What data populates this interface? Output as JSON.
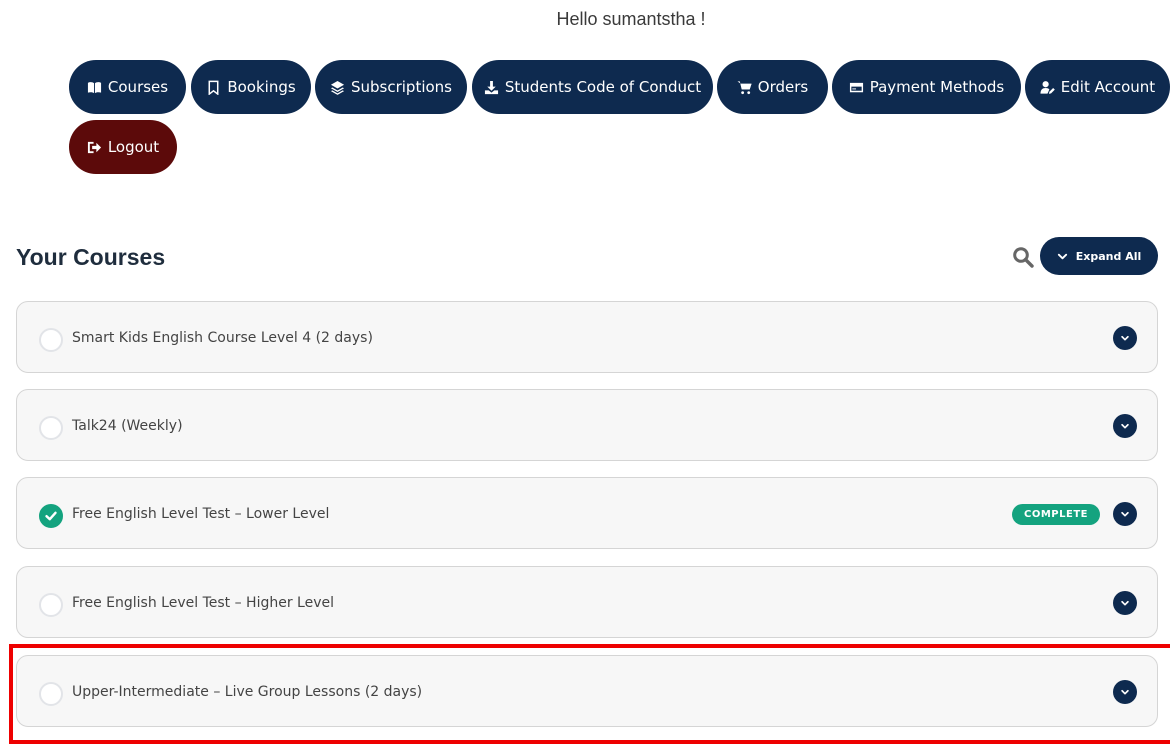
{
  "greeting": "Hello sumantstha !",
  "nav": {
    "courses": "Courses",
    "bookings": "Bookings",
    "subscriptions": "Subscriptions",
    "code_of_conduct": "Students Code of Conduct",
    "orders": "Orders",
    "payment_methods": "Payment Methods",
    "edit_account": "Edit Account",
    "logout": "Logout"
  },
  "section": {
    "title": "Your Courses",
    "expand_label": "Expand All"
  },
  "courses": [
    {
      "title": "Smart Kids English Course Level 4 (2 days)",
      "complete": false
    },
    {
      "title": "Talk24 (Weekly)",
      "complete": false
    },
    {
      "title": "Free English Level Test – Lower Level",
      "complete": true,
      "badge": "COMPLETE"
    },
    {
      "title": "Free English Level Test – Higher Level",
      "complete": false
    },
    {
      "title": "Upper-Intermediate – Live Group Lessons (2 days)",
      "complete": false
    }
  ],
  "colors": {
    "primary": "#0e2a4f",
    "logout": "#5c0a0a",
    "complete": "#14a37f",
    "highlight": "#ee0000"
  }
}
